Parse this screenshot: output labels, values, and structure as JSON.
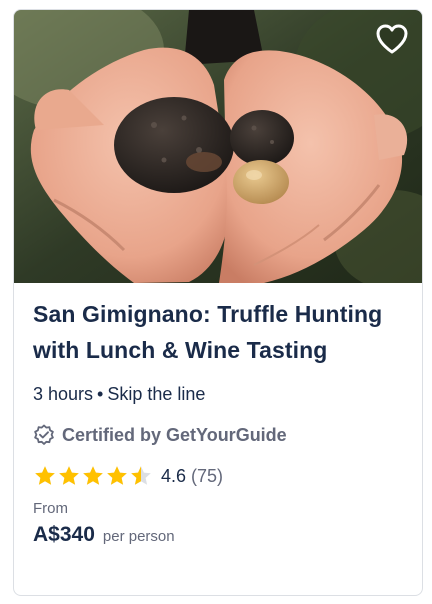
{
  "card": {
    "image_alt": "Hands holding black and white truffles",
    "wishlist_icon": "heart-outline-icon",
    "title": "San Gimignano: Truffle Hunting with Lunch & Wine Tasting",
    "duration": "3 hours",
    "separator": "•",
    "feature": "Skip the line",
    "certified_icon": "shield-check-icon",
    "certified_text": "Certified by GetYourGuide",
    "rating_value": "4.6",
    "rating_count": "(75)",
    "rating_stars": 4.6,
    "star_color": "#ffc100",
    "from_label": "From",
    "price": "A$340",
    "price_unit": "per person"
  }
}
